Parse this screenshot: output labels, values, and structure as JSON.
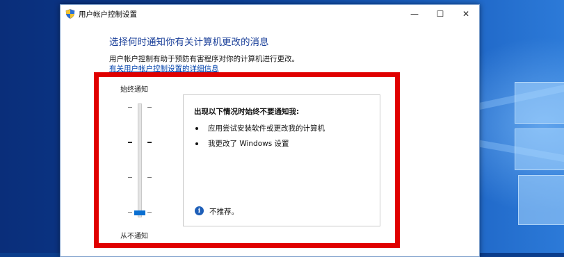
{
  "window": {
    "title": "用户帐户控制设置",
    "minimize_glyph": "—",
    "maximize_glyph": "☐",
    "close_glyph": "✕"
  },
  "main": {
    "heading": "选择何时通知你有关计算机更改的消息",
    "description": "用户帐户控制有助于预防有害程序对你的计算机进行更改。",
    "link": "有关用户帐户控制设置的详细信息"
  },
  "slider": {
    "top_label": "始终通知",
    "bottom_label": "从不通知",
    "levels": 4,
    "selected_level": 1
  },
  "info": {
    "title": "出现以下情况时始终不要通知我:",
    "bullets": [
      "应用尝试安装软件或更改我的计算机",
      "我更改了 Windows 设置"
    ],
    "note_icon": "i",
    "note": "不推荐。"
  },
  "colors": {
    "highlight": "#e00000",
    "heading": "#1a3f99",
    "link": "#0645ad",
    "thumb": "#0a6fd1"
  },
  "icons": {
    "title_icon": "uac-shield-icon",
    "info_icon": "info-icon"
  }
}
